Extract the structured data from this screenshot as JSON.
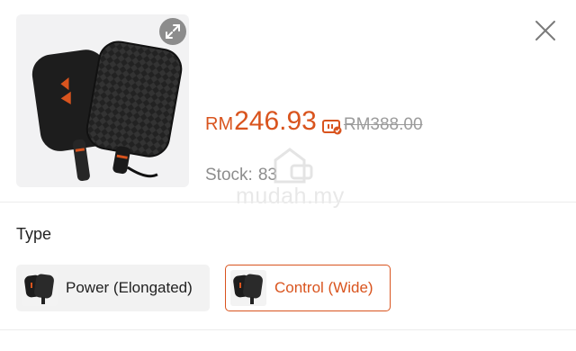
{
  "product": {
    "price_currency": "RM",
    "price_value": "246.93",
    "original_price": "RM388.00",
    "stock_label": "Stock:",
    "stock_value": "83"
  },
  "watermark": {
    "text": "mudah.my"
  },
  "variant": {
    "type_label": "Type",
    "options": [
      {
        "label": "Power (Elongated)",
        "selected": false
      },
      {
        "label": "Control (Wide)",
        "selected": true
      }
    ]
  },
  "icons": {
    "expand": "expand-arrows-icon",
    "close": "close-x-icon",
    "voucher": "voucher-ticket-icon"
  },
  "colors": {
    "accent": "#d9541e",
    "muted_text": "#9b9b9b",
    "image_bg": "#f2f2f3"
  }
}
